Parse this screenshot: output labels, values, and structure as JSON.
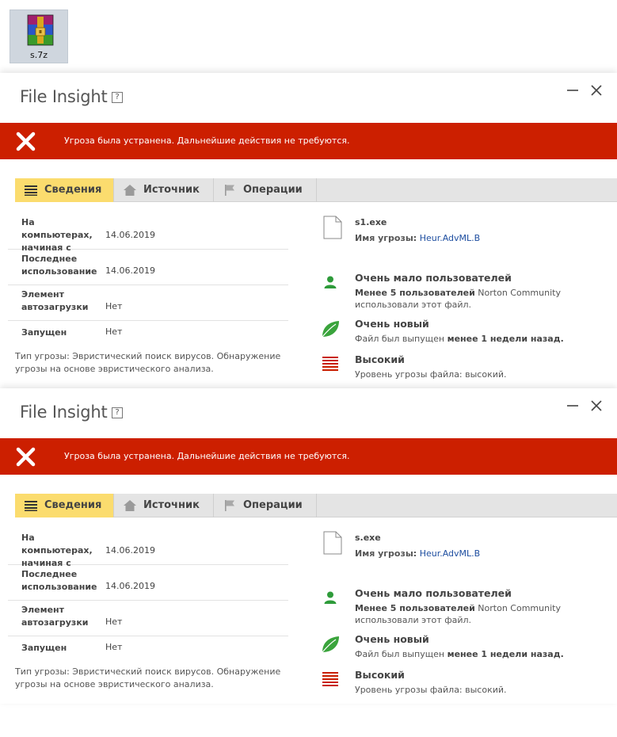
{
  "desktop": {
    "file_name": "s.7z",
    "file_icon": "winrar-archive-icon"
  },
  "windows": [
    {
      "title": "File Insight",
      "help_label": "?",
      "banner": {
        "message": "Угроза была устранена. Дальнейшие действия не требуются.",
        "color": "#cc1f00",
        "icon": "x-mark-icon"
      },
      "tabs": [
        {
          "label": "Сведения",
          "icon": "list-icon",
          "active": true
        },
        {
          "label": "Источник",
          "icon": "home-icon",
          "active": false
        },
        {
          "label": "Операции",
          "icon": "flag-icon",
          "active": false
        }
      ],
      "details": [
        {
          "label": "На компьютерах, начиная с",
          "value": "14.06.2019"
        },
        {
          "label": "Последнее использование",
          "value": "14.06.2019"
        },
        {
          "label": "Элемент автозагрузки",
          "value": "Нет"
        },
        {
          "label": "Запущен",
          "value": "Нет"
        }
      ],
      "threat_type": "Тип угрозы: Эвристический поиск вирусов. Обнаружение угрозы на основе эвристического анализа.",
      "file_name": "s1.exe",
      "threat_name_label": "Имя угрозы:",
      "threat_name": "Heur.AdvML.B",
      "stats": [
        {
          "heading": "Очень мало пользователей",
          "desc_bold": "Менее 5 пользователей",
          "desc_rest": " Norton Community использовали этот файл.",
          "icon": "user-icon"
        },
        {
          "heading": "Очень новый",
          "desc_text": "Файл был выпущен ",
          "desc_bold": "менее 1 недели назад.",
          "icon": "leaf-icon"
        },
        {
          "heading": "Высокий",
          "desc_text": "Уровень угрозы файла: высокий.",
          "icon": "threat-level-icon"
        }
      ]
    },
    {
      "title": "File Insight",
      "help_label": "?",
      "banner": {
        "message": "Угроза была устранена. Дальнейшие действия не требуются.",
        "color": "#cc1f00",
        "icon": "x-mark-icon"
      },
      "tabs": [
        {
          "label": "Сведения",
          "icon": "list-icon",
          "active": true
        },
        {
          "label": "Источник",
          "icon": "home-icon",
          "active": false
        },
        {
          "label": "Операции",
          "icon": "flag-icon",
          "active": false
        }
      ],
      "details": [
        {
          "label": "На компьютерах, начиная с",
          "value": "14.06.2019"
        },
        {
          "label": "Последнее использование",
          "value": "14.06.2019"
        },
        {
          "label": "Элемент автозагрузки",
          "value": "Нет"
        },
        {
          "label": "Запущен",
          "value": "Нет"
        }
      ],
      "threat_type": "Тип угрозы: Эвристический поиск вирусов. Обнаружение угрозы на основе эвристического анализа.",
      "file_name": "s.exe",
      "threat_name_label": "Имя угрозы:",
      "threat_name": "Heur.AdvML.B",
      "stats": [
        {
          "heading": "Очень мало пользователей",
          "desc_bold": "Менее 5 пользователей",
          "desc_rest": " Norton Community использовали этот файл.",
          "icon": "user-icon"
        },
        {
          "heading": "Очень новый",
          "desc_text": "Файл был выпущен ",
          "desc_bold": "менее 1 недели назад.",
          "icon": "leaf-icon"
        },
        {
          "heading": "Высокий",
          "desc_text": "Уровень угрозы файла: высокий.",
          "icon": "threat-level-icon"
        }
      ]
    }
  ],
  "colors": {
    "accent_tab": "#fbdc6e",
    "banner_red": "#cc1f00",
    "link_blue": "#1e4ea0",
    "green": "#2e9b3a"
  }
}
